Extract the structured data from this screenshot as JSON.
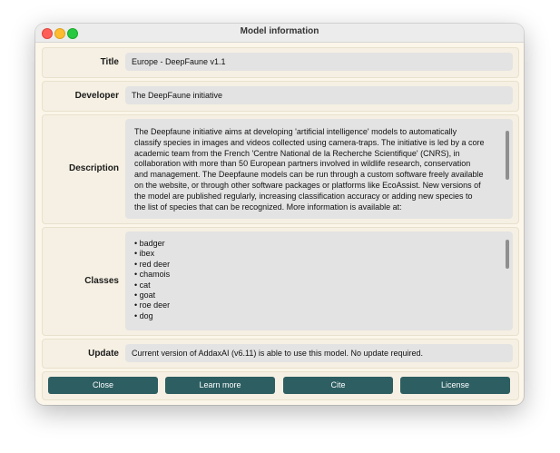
{
  "window": {
    "title": "Model information"
  },
  "title_row": {
    "label": "Title",
    "value": "Europe - DeepFaune v1.1"
  },
  "developer_row": {
    "label": "Developer",
    "value": "The DeepFaune initiative"
  },
  "description_row": {
    "label": "Description",
    "lines": [
      "The Deepfaune initiative aims at developing 'artificial intelligence' models to automatically",
      "classify species in images and videos collected using camera-traps. The initiative is led by a core",
      "academic team from the French 'Centre National de la Recherche Scientifique' (CNRS), in",
      "collaboration with more than 50 European partners involved in wildlife research, conservation",
      "and management. The Deepfaune models can be run through a custom software freely available",
      "on the website, or through other software packages or platforms like EcoAssist. New versions of",
      "the model are published regularly, increasing classification accuracy or adding new species to",
      "the list of species that can be recognized. More information is available at:"
    ]
  },
  "classes_row": {
    "label": "Classes",
    "items": [
      "• badger",
      "• ibex",
      "• red deer",
      "• chamois",
      "• cat",
      "• goat",
      "• roe deer",
      "• dog"
    ]
  },
  "update_row": {
    "label": "Update",
    "value": "Current version of AddaxAI (v6.11) is able to use this model. No update required."
  },
  "buttons": {
    "close": "Close",
    "learn_more": "Learn more",
    "cite": "Cite",
    "license": "License"
  },
  "colors": {
    "button": "#2d5e62",
    "panel": "#fbf6e9",
    "field": "#e3e3e3"
  }
}
